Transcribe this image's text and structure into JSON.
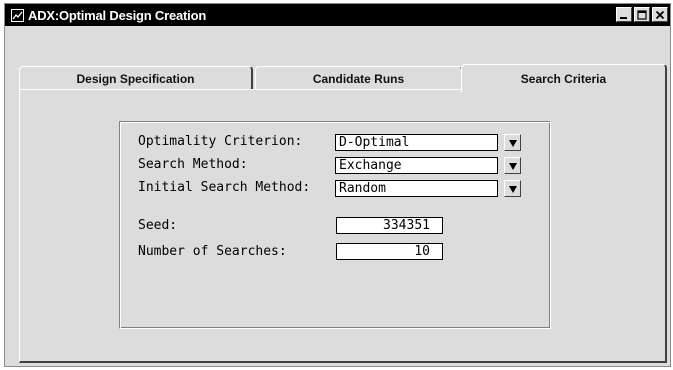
{
  "window": {
    "title": "ADX:Optimal Design Creation"
  },
  "tabs": [
    {
      "label": "Design Specification",
      "active": false
    },
    {
      "label": "Candidate Runs",
      "active": false
    },
    {
      "label": "Search Criteria",
      "active": true
    }
  ],
  "form": {
    "optimality_criterion": {
      "label": "Optimality Criterion:",
      "value": "D-Optimal"
    },
    "search_method": {
      "label": "Search Method:",
      "value": "Exchange"
    },
    "initial_search_method": {
      "label": "Initial Search Method:",
      "value": "Random"
    },
    "seed": {
      "label": "Seed:",
      "value": "334351"
    },
    "number_of_searches": {
      "label": "Number of Searches:",
      "value": "10"
    }
  },
  "icons": {
    "app": "graph-app-icon",
    "minimize": "minimize-icon",
    "maximize": "maximize-icon",
    "close": "close-icon",
    "dropdown": "dropdown-arrow-icon"
  }
}
